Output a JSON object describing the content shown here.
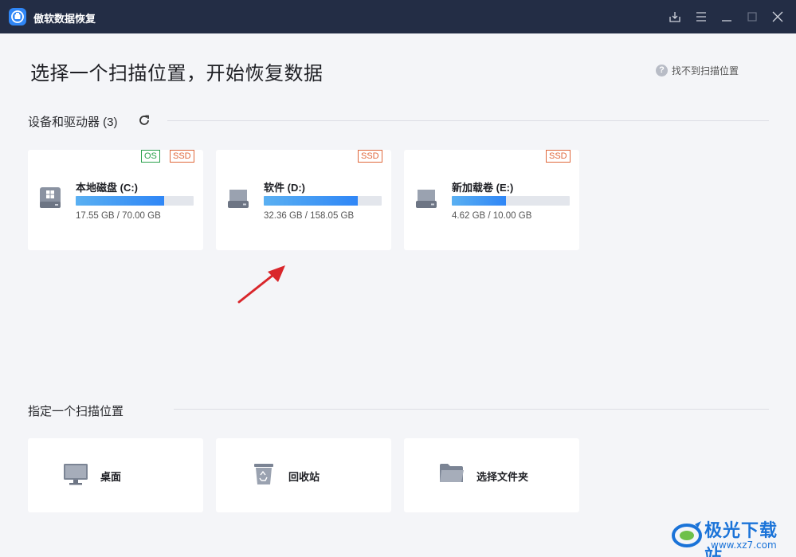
{
  "app": {
    "title": "傲软数据恢复"
  },
  "header": {
    "page_title": "选择一个扫描位置，开始恢复数据",
    "help_link": "找不到扫描位置",
    "help_icon_glyph": "?"
  },
  "devices": {
    "section_title": "设备和驱动器 (3)",
    "drives": [
      {
        "name": "本地磁盘 (C:)",
        "size_text": "17.55 GB / 70.00 GB",
        "used_fraction": 0.748,
        "badges": [
          "OS",
          "SSD"
        ],
        "icon": "windows-drive-icon"
      },
      {
        "name": "软件 (D:)",
        "size_text": "32.36 GB / 158.05 GB",
        "used_fraction": 0.795,
        "badges": [
          "SSD"
        ],
        "icon": "hard-drive-icon"
      },
      {
        "name": "新加载卷 (E:)",
        "size_text": "4.62 GB / 10.00 GB",
        "used_fraction": 0.462,
        "badges": [
          "SSD"
        ],
        "icon": "hard-drive-icon"
      }
    ]
  },
  "locations": {
    "section_title": "指定一个扫描位置",
    "items": [
      {
        "label": "桌面",
        "icon": "desktop-icon"
      },
      {
        "label": "回收站",
        "icon": "recycle-bin-icon"
      },
      {
        "label": "选择文件夹",
        "icon": "folder-icon"
      }
    ]
  },
  "watermark": {
    "text": "极光下载站",
    "url": "www.xz7.com"
  },
  "colors": {
    "titlebar": "#232d45",
    "accent": "#2f86f6",
    "os_badge": "#2aa04c",
    "ssd_badge": "#e0683c",
    "annotation_arrow": "#d9262b"
  }
}
